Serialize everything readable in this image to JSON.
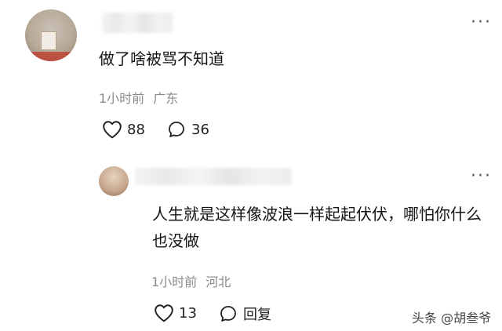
{
  "comments": [
    {
      "text": "做了啥被骂不知道",
      "time": "1小时前",
      "location": "广东",
      "likes": "88",
      "replies": "36",
      "more_label": "⋮"
    },
    {
      "text": "人生就是这样像波浪一样起起伏伏，哪怕你什么也没做",
      "time": "1小时前",
      "location": "河北",
      "likes": "13",
      "reply_label": "回复",
      "more_label": "⋮"
    }
  ],
  "watermark": "头条 @胡叁爷",
  "icons": {
    "like": "heart-outline-icon",
    "reply": "speech-bubble-icon",
    "more": "more-dots-icon"
  },
  "colors": {
    "text": "#141414",
    "meta": "#8a8a8a",
    "background": "#ffffff"
  }
}
